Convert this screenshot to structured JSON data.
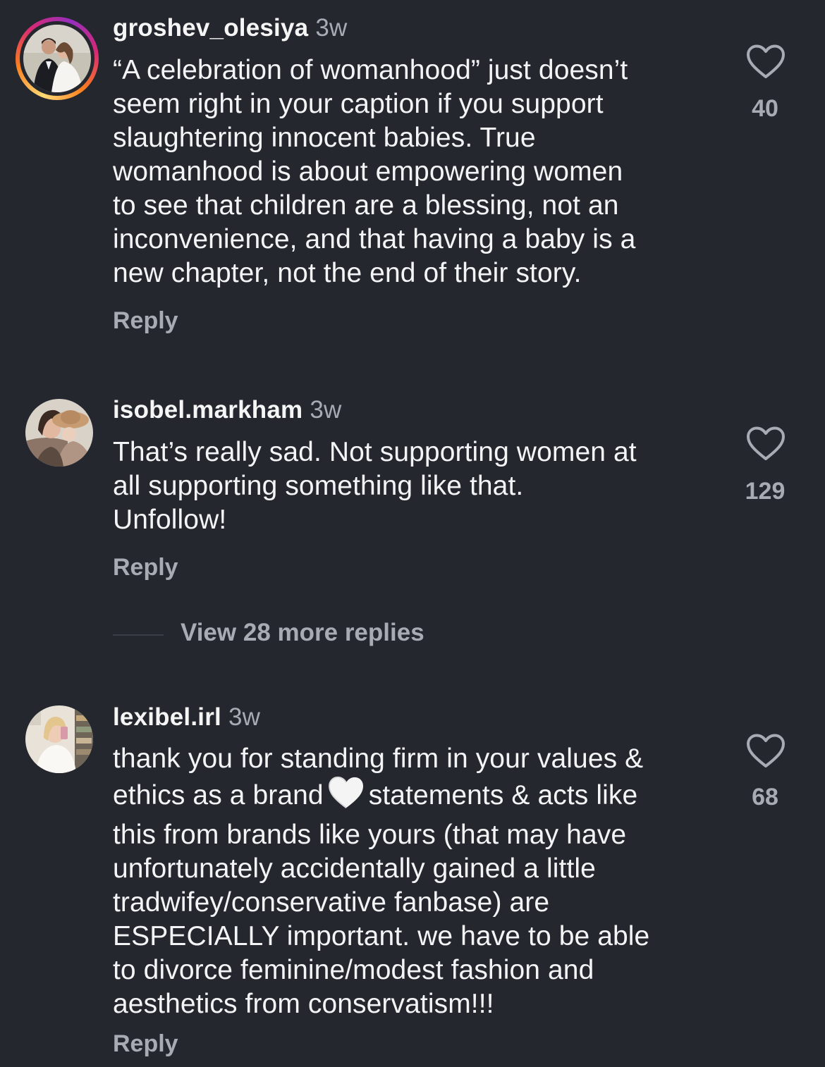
{
  "colors": {
    "background": "#24272e",
    "text_primary": "#f3f4f6",
    "text_secondary": "#a8abb3"
  },
  "comments": [
    {
      "username": "groshev_olesiya",
      "time": "3w",
      "has_story_ring": true,
      "lines": [
        "“A celebration of womanhood” just doesn’t",
        "seem right in your caption if you support",
        "slaughtering innocent babies. True",
        "womanhood is about empowering women",
        "to see that children are a blessing, not an",
        "inconvenience, and that having a baby is a",
        "new chapter, not the end of their story."
      ],
      "reply_label": "Reply",
      "like_count": "40",
      "like_icon": "heart-outline-icon"
    },
    {
      "username": "isobel.markham",
      "time": "3w",
      "has_story_ring": false,
      "lines": [
        "That’s really sad. Not supporting women at",
        "all supporting something like that.",
        "Unfollow!"
      ],
      "reply_label": "Reply",
      "like_count": "129",
      "like_icon": "heart-outline-icon",
      "view_replies_label": "View 28 more replies"
    },
    {
      "username": "lexibel.irl",
      "time": "3w",
      "has_story_ring": false,
      "lines": [
        "thank you for standing firm in your values &",
        "ethics as a brand",
        "statements & acts like",
        "this from brands like yours (that may have",
        "unfortunately accidentally gained a little",
        "tradwifey/conservative fanbase) are",
        "ESPECIALLY important. we have to be able",
        "to divorce feminine/modest fashion and",
        "aesthetics from conservatism!!!"
      ],
      "inline_emoji": "white-heart-emoji",
      "reply_label": "Reply",
      "like_count": "68",
      "like_icon": "heart-outline-icon"
    }
  ]
}
